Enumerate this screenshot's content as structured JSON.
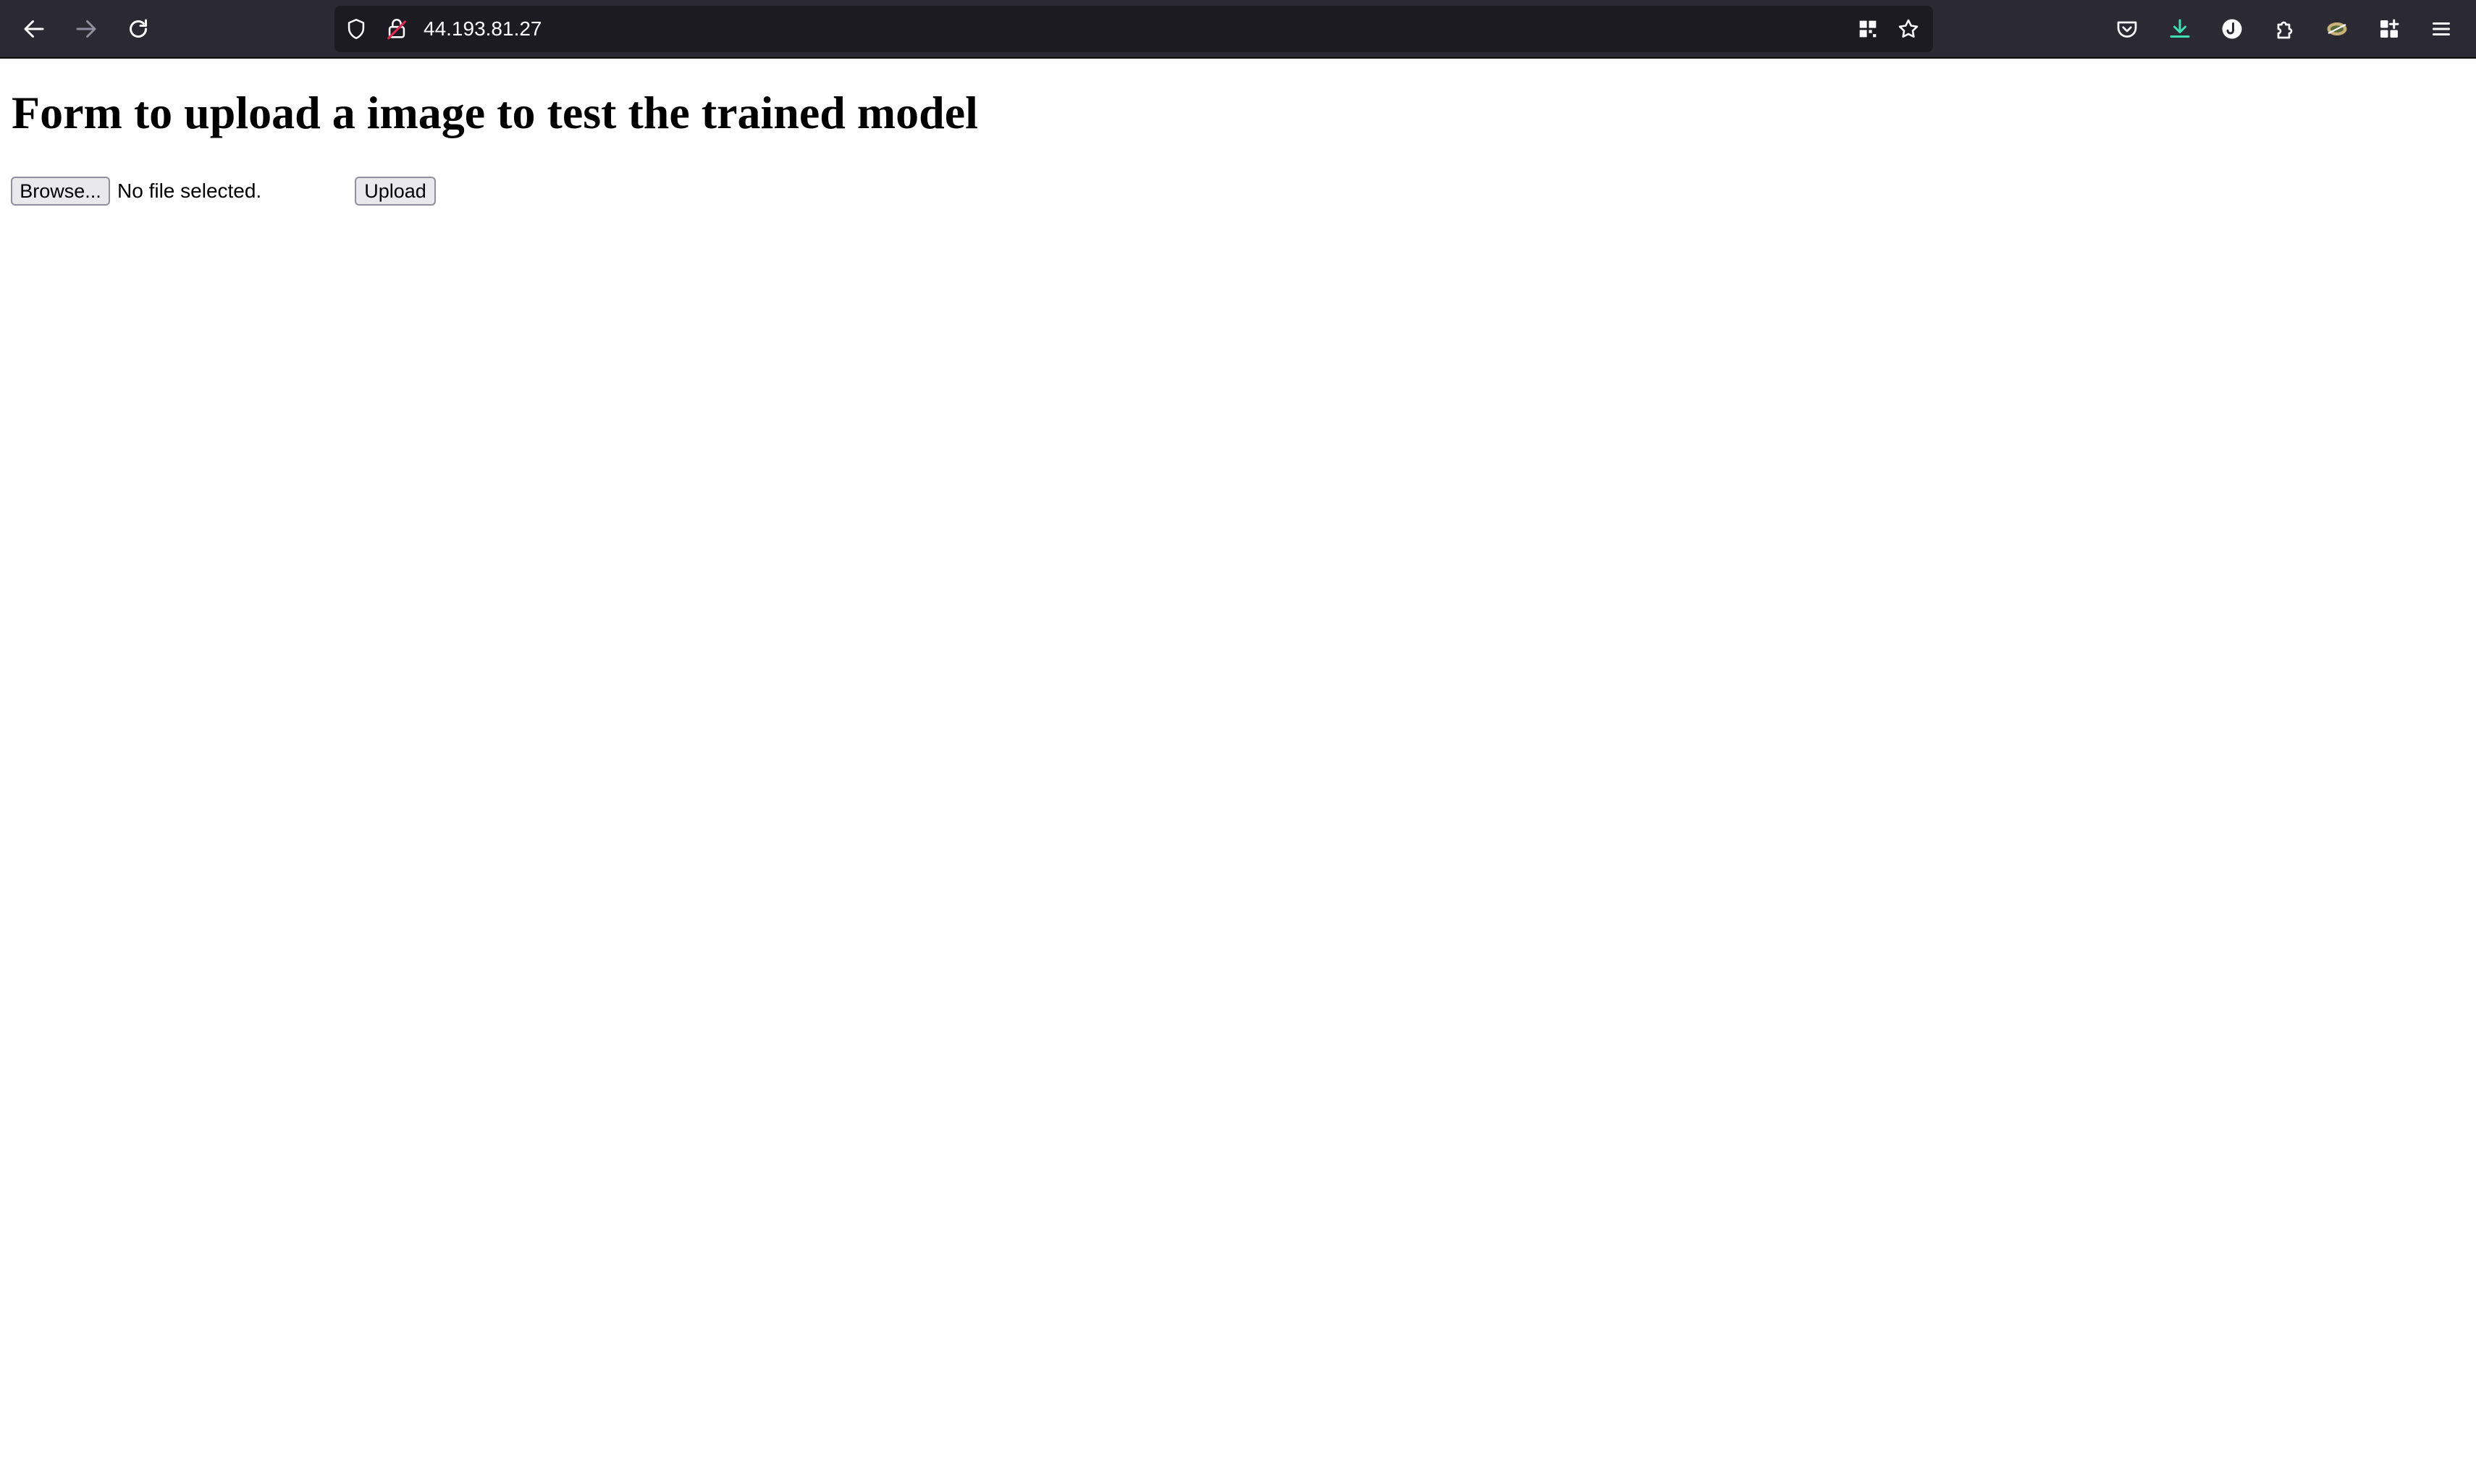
{
  "browser": {
    "url": "44.193.81.27",
    "toolbar_icons": {
      "back": "back-arrow-icon",
      "forward": "forward-arrow-icon",
      "reload": "reload-icon",
      "tracking_protection": "shield-icon",
      "connection": "insecure-lock-icon",
      "qr_code": "qr-code-icon",
      "bookmark": "star-icon",
      "pocket": "pocket-icon",
      "downloads": "download-icon",
      "account": "account-icon",
      "extensions": "puzzle-icon",
      "extension_item": "extension-icon",
      "more_tools": "apps-icon",
      "menu": "hamburger-menu-icon"
    },
    "colors": {
      "toolbar_bg": "#2b2a33",
      "urlbar_bg": "#1c1b22",
      "download_accent": "#3fe1b0",
      "insecure_accent": "#e22850"
    }
  },
  "page": {
    "heading": "Form to upload a image to test the trained model",
    "form": {
      "browse_label": "Browse...",
      "file_status": "No file selected.",
      "upload_label": "Upload"
    }
  }
}
